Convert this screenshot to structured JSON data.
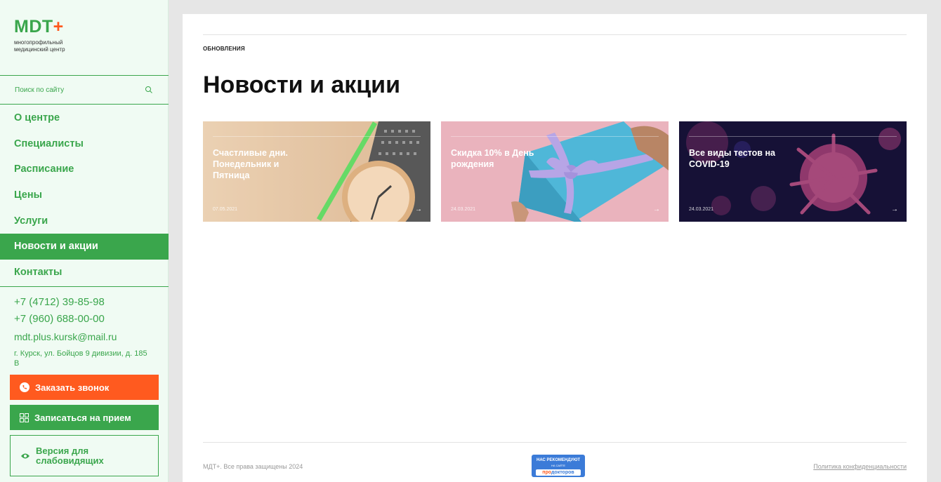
{
  "brand": {
    "name": "MDT",
    "plus": "+",
    "tagline": "многопрофильный медицинский центр",
    "accent": "#3aa64c",
    "orange": "#ff5a1f"
  },
  "search": {
    "placeholder": "Поиск по сайту",
    "icon": "search-icon"
  },
  "nav": {
    "items": [
      {
        "label": "О центре"
      },
      {
        "label": "Специалисты"
      },
      {
        "label": "Расписание"
      },
      {
        "label": "Цены"
      },
      {
        "label": "Услуги"
      },
      {
        "label": "Новости и акции",
        "active": true
      },
      {
        "label": "Контакты"
      }
    ]
  },
  "contacts": {
    "phone1": "+7 (4712) 39-85-98",
    "phone2": "+7 (960) 688-00-00",
    "email": "mdt.plus.kursk@mail.ru",
    "address": "г. Курск, ул. Бойцов 9 дивизии, д. 185 В"
  },
  "buttons": {
    "call": "Заказать звонок",
    "book": "Записаться на прием",
    "vision": "Версия для слабовидящих"
  },
  "main": {
    "section_label": "ОБНОВЛЕНИЯ",
    "title": "Новости и акции",
    "cards": [
      {
        "title": "Счастливые дни. Понедельник и Пятница",
        "date": "07.05.2021",
        "arrow": "→"
      },
      {
        "title": "Скидка 10% в День рождения",
        "date": "24.03.2021",
        "arrow": "→"
      },
      {
        "title": "Все виды тестов на COVID-19",
        "date": "24.03.2021",
        "arrow": "→"
      }
    ]
  },
  "footer": {
    "copyright": "МДТ+. Все права защищены 2024",
    "badge_top": "НАС РЕКОМЕНДУЮТ",
    "badge_mid": "НА САЙТЕ",
    "badge_pro": "про",
    "badge_doctors": "докторов",
    "privacy": "Политика конфиденциальности"
  }
}
